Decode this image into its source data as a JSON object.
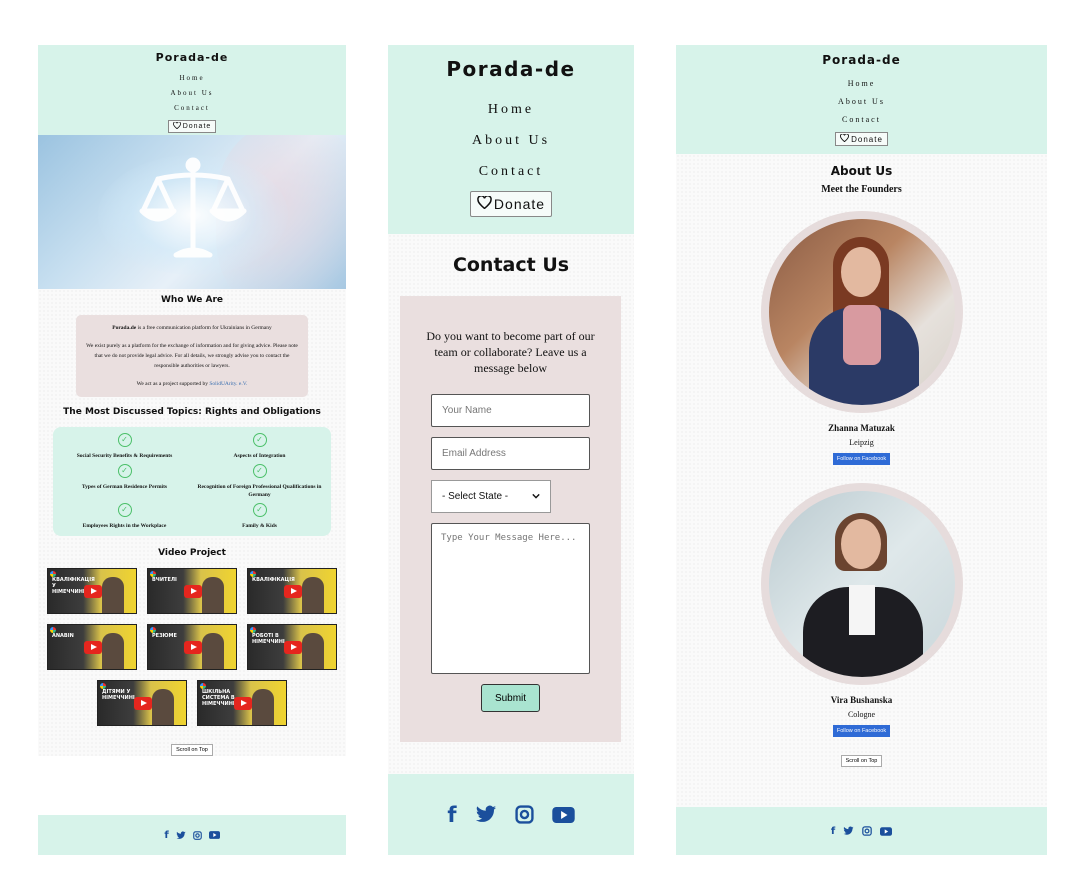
{
  "brand": "Porada-de",
  "nav": [
    "Home",
    "About Us",
    "Contact"
  ],
  "donate_label": "Donate",
  "home": {
    "who_title": "Who We Are",
    "who_p1_strong": "Porada.de",
    "who_p1_rest": " is a free communication platform for Ukrainians in Germany",
    "who_p2": "We exist purely as a platform for the exchange of information and for giving advice. Please note that we do not provide legal advice. For all details, we strongly advise you to contact the responsible authorities or lawyers.",
    "who_p3_pre": "We act as a project supported by ",
    "who_p3_link": "SolidUArity. e.V.",
    "topics_title": "The Most Discussed Topics: Rights and Obligations",
    "topics": [
      "Social Security Benefits & Requirements",
      "Aspects of Integration",
      "Types of German Residence Permits",
      "Recognition of Foreign Professional Qualifications in Germany",
      "Employees Rights in the Workplace",
      "Family & Kids"
    ],
    "video_title": "Video Project",
    "videos": [
      "КВАЛІФІКАЦІЯ У НІМЕЧЧИНІ",
      "ВЧИТЕЛІ",
      "КВАЛІФІКАЦІЯ",
      "ANABIN",
      "РЕЗЮМЕ",
      "РОБОТІ В НІМЕЧЧИНІ",
      "ДІТЯМИ У НІМЕЧЧИНІ",
      "ШКІЛЬНА СИСТЕМА В НІМЕЧЧИНІ"
    ],
    "scroll_top": "Scroll on Top"
  },
  "contact": {
    "title": "Contact Us",
    "intro": "Do you want to become part of our team or collaborate? Leave us a message below",
    "name_placeholder": "Your Name",
    "email_placeholder": "Email Address",
    "select_value": "- Select State -",
    "message_placeholder": "Type Your Message Here...",
    "submit": "Submit"
  },
  "about": {
    "title": "About Us",
    "subtitle": "Meet the Founders",
    "founders": [
      {
        "name": "Zhanna Matuzak",
        "city": "Leipzig",
        "button": "Follow on Facebook"
      },
      {
        "name": "Vira Bushanska",
        "city": "Cologne",
        "button": "Follow on Facebook"
      }
    ],
    "scroll_top": "Scroll on Top"
  },
  "social_icons": [
    "facebook-icon",
    "twitter-icon",
    "instagram-icon",
    "youtube-icon"
  ],
  "colors": {
    "mint": "#d7f3ea",
    "card": "#eadfdf",
    "social": "#1b4f9c",
    "facebook_button": "#2f6bd6",
    "check": "#4cc06a"
  }
}
